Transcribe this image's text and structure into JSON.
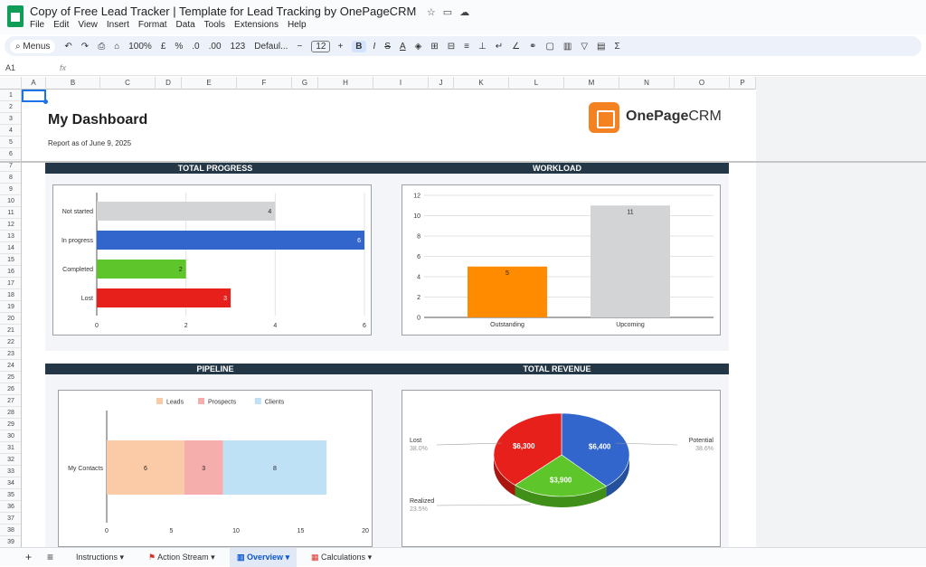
{
  "app": {
    "title": "Copy of Free Lead Tracker | Template for Lead Tracking by OnePageCRM",
    "menus": [
      "File",
      "Edit",
      "View",
      "Insert",
      "Format",
      "Data",
      "Tools",
      "Extensions",
      "Help"
    ],
    "title_icons": [
      "star-icon",
      "folder-icon",
      "cloud-icon"
    ]
  },
  "toolbar": {
    "menus_label": "Menus",
    "zoom": "100%",
    "currency": "£",
    "percent": "%",
    "decrease_decimal": ".0",
    "increase_decimal": ".00",
    "number_format": "123",
    "font": "Defaul...",
    "font_size": "12",
    "bold": "B",
    "italic": "I",
    "strike": "S",
    "text_color": "A",
    "sum": "Σ"
  },
  "formula_bar": {
    "cell_ref": "A1",
    "fx": "fx",
    "value": ""
  },
  "columns": [
    "A",
    "B",
    "C",
    "D",
    "E",
    "F",
    "G",
    "H",
    "I",
    "J",
    "K",
    "L",
    "M",
    "N",
    "O",
    "P"
  ],
  "rows": [
    "1",
    "2",
    "3",
    "4",
    "5",
    "6",
    "7",
    "8",
    "9",
    "10",
    "11",
    "12",
    "13",
    "14",
    "15",
    "16",
    "17",
    "18",
    "19",
    "20",
    "21",
    "22",
    "23",
    "24",
    "25",
    "26",
    "27",
    "28",
    "29",
    "30",
    "31",
    "32",
    "33",
    "34",
    "35",
    "36",
    "37",
    "38",
    "39"
  ],
  "dashboard": {
    "title": "My Dashboard",
    "report": "Report as of June 9, 2025",
    "brand_main": "OnePage",
    "brand_suffix": "CRM"
  },
  "sections": {
    "total_progress": "TOTAL PROGRESS",
    "workload": "WORKLOAD",
    "pipeline": "PIPELINE",
    "total_revenue": "TOTAL REVENUE"
  },
  "chart_data": [
    {
      "type": "bar",
      "orientation": "horizontal",
      "categories": [
        "Not started",
        "In progress",
        "Completed",
        "Lost"
      ],
      "values": [
        4,
        6,
        2,
        3
      ],
      "colors": [
        "#d2d4d6",
        "#3366cc",
        "#5ec62a",
        "#e8201c"
      ],
      "xlim": [
        0,
        6
      ],
      "xticks": [
        0,
        2,
        4,
        6
      ],
      "data_labels": true,
      "grid": true
    },
    {
      "type": "bar",
      "categories": [
        "Outstanding",
        "Upcoming"
      ],
      "values": [
        5,
        11
      ],
      "colors": [
        "#ff8c00",
        "#d2d4d6"
      ],
      "ylim": [
        0,
        12
      ],
      "yticks": [
        0,
        2,
        4,
        6,
        8,
        10,
        12
      ],
      "data_labels": true,
      "grid": true
    },
    {
      "type": "bar",
      "orientation": "horizontal",
      "stacked": true,
      "categories": [
        "My Contacts"
      ],
      "series": [
        {
          "name": "Leads",
          "values": [
            6
          ],
          "color": "#fbcba8"
        },
        {
          "name": "Prospects",
          "values": [
            3
          ],
          "color": "#f6aeac"
        },
        {
          "name": "Clients",
          "values": [
            8
          ],
          "color": "#bfe1f6"
        }
      ],
      "xlim": [
        0,
        20
      ],
      "xticks": [
        0,
        5,
        10,
        15,
        20
      ],
      "legend": "top",
      "data_labels": true
    },
    {
      "type": "pie",
      "style": "3d",
      "slices": [
        {
          "label": "Potential",
          "value": 6400,
          "display": "$6,400",
          "percent": "38.6%",
          "color": "#3366cc",
          "side": "#24509c"
        },
        {
          "label": "Realized",
          "value": 3900,
          "display": "$3,900",
          "percent": "23.5%",
          "color": "#5ec62a",
          "side": "#3f8f18"
        },
        {
          "label": "Lost",
          "value": 6300,
          "display": "$6,300",
          "percent": "38.0%",
          "color": "#e8201c",
          "side": "#a9160f"
        }
      ]
    }
  ],
  "sheet_tabs": {
    "add_icon": "+",
    "list_icon": "≡",
    "tabs": [
      {
        "label": "Instructions",
        "icon": ""
      },
      {
        "label": "Action Stream",
        "icon": "flag-icon"
      },
      {
        "label": "Overview",
        "icon": "chart-icon"
      },
      {
        "label": "Calculations",
        "icon": "calendar-icon"
      }
    ],
    "active": "Overview"
  }
}
